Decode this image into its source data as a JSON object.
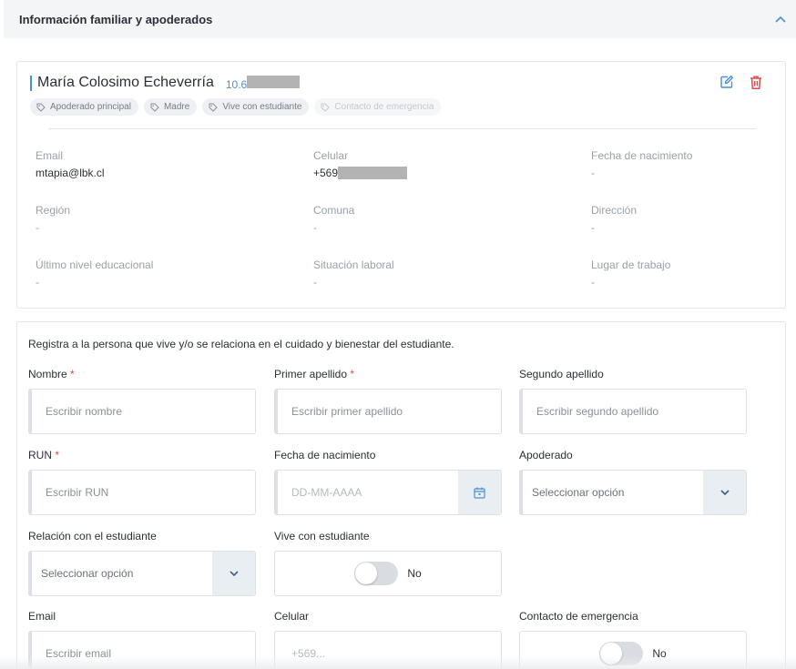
{
  "section": {
    "title": "Información familiar y apoderados"
  },
  "person": {
    "name": "María Colosimo Echeverría",
    "run_prefix": "10.6",
    "tags": [
      "Apoderado principal",
      "Madre",
      "Vive con estudiante",
      "Contacto de emergencia"
    ]
  },
  "details": {
    "email": {
      "label": "Email",
      "value": "mtapia@lbk.cl"
    },
    "celular": {
      "label": "Celular",
      "value": "+569"
    },
    "fecha_nacimiento": {
      "label": "Fecha de nacimiento",
      "value": "-"
    },
    "region": {
      "label": "Región",
      "value": "-"
    },
    "comuna": {
      "label": "Comuna",
      "value": "-"
    },
    "direccion": {
      "label": "Dirección",
      "value": "-"
    },
    "nivel_educacional": {
      "label": "Último nivel educacional",
      "value": "-"
    },
    "situacion_laboral": {
      "label": "Situación laboral",
      "value": "-"
    },
    "lugar_trabajo": {
      "label": "Lugar de trabajo",
      "value": "-"
    }
  },
  "form": {
    "intro": "Registra a la persona que vive y/o se relaciona en el cuidado y bienestar del estudiante.",
    "required_mark": "*",
    "nombre": {
      "label": "Nombre",
      "placeholder": "Escribir nombre"
    },
    "primer_apellido": {
      "label": "Primer apellido",
      "placeholder": "Escribir primer apellido"
    },
    "segundo_apellido": {
      "label": "Segundo apellido",
      "placeholder": "Escribir segundo apellido"
    },
    "run": {
      "label": "RUN",
      "placeholder": "Escribir RUN"
    },
    "fecha_nacimiento": {
      "label": "Fecha de nacimiento",
      "placeholder": "DD-MM-AAAA"
    },
    "apoderado": {
      "label": "Apoderado",
      "value": "Seleccionar opción"
    },
    "relacion": {
      "label": "Relación con el estudiante",
      "value": "Seleccionar opción"
    },
    "vive_con": {
      "label": "Vive con estudiante",
      "toggle_text": "No"
    },
    "email": {
      "label": "Email",
      "placeholder": "Escribir email"
    },
    "celular": {
      "label": "Celular",
      "placeholder": "+569..."
    },
    "contacto_emergencia": {
      "label": "Contacto de emergencia",
      "toggle_text": "No"
    }
  },
  "colors": {
    "accent": "#4a90d9",
    "danger": "#e0484b",
    "required": "#e0484b"
  },
  "icons": [
    "chevron-up-icon",
    "edit-icon",
    "trash-icon",
    "tag-icon",
    "calendar-icon",
    "chevron-down-icon"
  ]
}
